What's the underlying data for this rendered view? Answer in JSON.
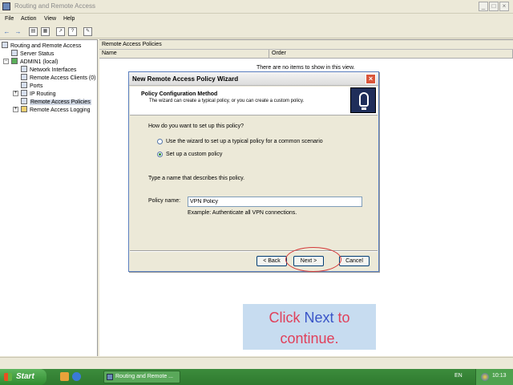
{
  "window": {
    "title": "Routing and Remote Access",
    "controls": [
      "_",
      "□",
      "×"
    ]
  },
  "menu": {
    "file": "File",
    "action": "Action",
    "view": "View",
    "help": "Help"
  },
  "toolbar": {
    "back_icon": "arrow-left-icon",
    "forward_icon": "arrow-right-icon",
    "buttons": [
      "back",
      "forward",
      "up",
      "show-hide-tree",
      "export",
      "help",
      "properties"
    ]
  },
  "tree": {
    "root": "Routing and Remote Access",
    "server_status": "Server Status",
    "server": "ADMIN1 (local)",
    "network_interfaces": "Network Interfaces",
    "remote_access_clients": "Remote Access Clients (0)",
    "ports": "Ports",
    "ip_routing": "IP Routing",
    "remote_access_policies": "Remote Access Policies",
    "remote_access_logging": "Remote Access Logging"
  },
  "right_pane": {
    "title": "Remote Access Policies",
    "col_name": "Name",
    "col_order": "Order",
    "empty_message": "There are no items to show in this view."
  },
  "dialog": {
    "title": "New Remote Access Policy Wizard",
    "close": "×",
    "header_title": "Policy Configuration Method",
    "header_subtitle": "The wizard can create a typical policy, or you can create a custom policy.",
    "question": "How do you want to set up this policy?",
    "option_wizard": "Use the wizard to set up a typical policy for a common scenario",
    "option_custom": "Set up a custom policy",
    "selected_option": "custom",
    "name_prompt": "Type a name that describes this policy.",
    "policy_name_label": "Policy name:",
    "policy_name_value": "VPN Policy",
    "example": "Example: Authenticate all VPN connections.",
    "back_button": "< Back",
    "next_button": "Next >",
    "cancel_button": "Cancel"
  },
  "callout": {
    "part1": "Click ",
    "highlight": "Next",
    "part2": " to",
    "line2": "continue."
  },
  "taskbar": {
    "start": "Start",
    "task_label": "Routing and Remote ...",
    "language": "EN",
    "clock": "10:13"
  },
  "colors": {
    "accent": "#2f7a2f",
    "callout_text": "#e0405a",
    "callout_highlight": "#3a55c8",
    "callout_bg": "#c7dcf0",
    "circle": "#d43a3a"
  }
}
